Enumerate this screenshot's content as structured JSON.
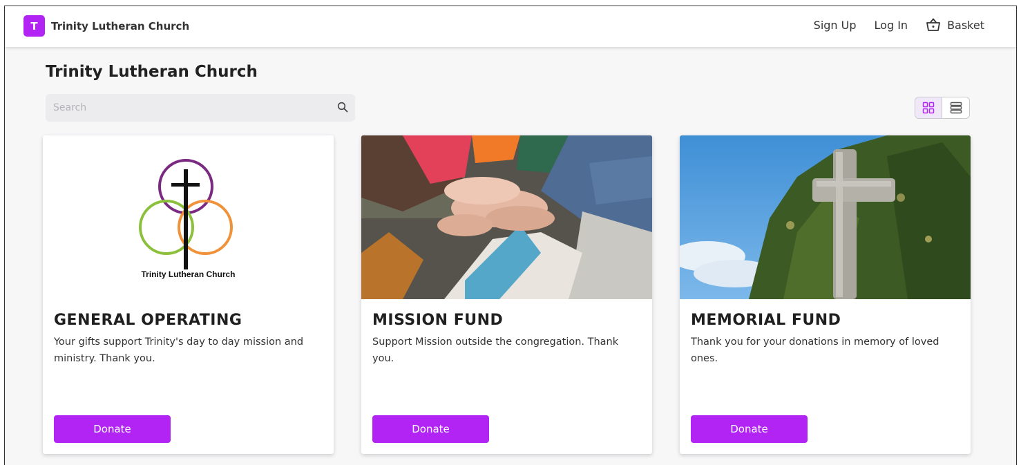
{
  "header": {
    "brand_initial": "T",
    "brand_name": "Trinity Lutheran Church",
    "nav": {
      "signup": "Sign Up",
      "login": "Log In",
      "basket": "Basket"
    }
  },
  "page": {
    "title": "Trinity Lutheran Church"
  },
  "search": {
    "placeholder": "Search"
  },
  "view_toggle": {
    "selected": "grid"
  },
  "funds": [
    {
      "title": "GENERAL OPERATING",
      "description": "Your gifts support Trinity's day to day mission and ministry. Thank you.",
      "button": "Donate",
      "logo_caption": "Trinity Lutheran Church"
    },
    {
      "title": "MISSION FUND",
      "description": "Support Mission outside the congregation. Thank you.",
      "button": "Donate"
    },
    {
      "title": "MEMORIAL FUND",
      "description": "Thank you for your donations in memory of loved ones.",
      "button": "Donate"
    }
  ],
  "colors": {
    "accent": "#b124f4",
    "background": "#f7f7f8"
  }
}
